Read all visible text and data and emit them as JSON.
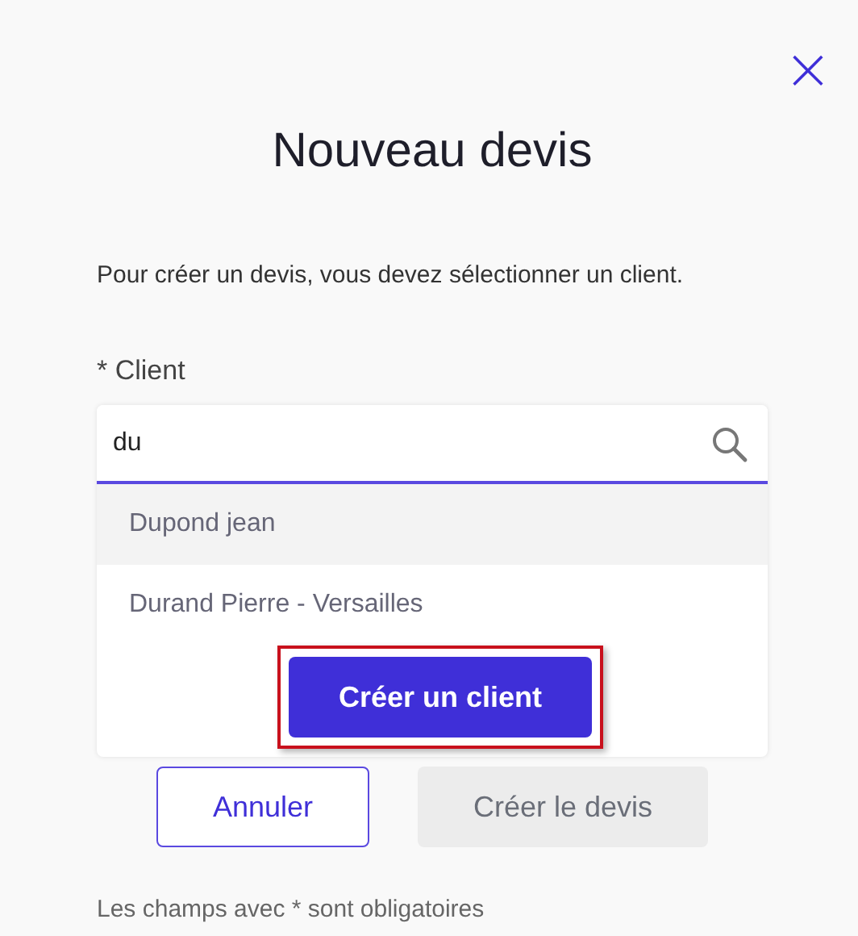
{
  "dialog": {
    "title": "Nouveau devis",
    "close": "×",
    "description": "Pour créer un devis, vous devez sélectionner un client."
  },
  "client_field": {
    "label": "* Client",
    "value": "du"
  },
  "suggestions": [
    {
      "label": "Dupond jean",
      "selected": true
    },
    {
      "label": "Durand Pierre - Versailles",
      "selected": false
    }
  ],
  "create_client_button": {
    "label": "Créer un client",
    "highlighted": true
  },
  "buttons": [
    {
      "label": "Annuler",
      "kind": "outline",
      "disabled": false
    },
    {
      "label": "Créer le devis",
      "kind": "filled",
      "disabled": true
    }
  ],
  "footer": "Les champs avec * sont obligatoires"
}
